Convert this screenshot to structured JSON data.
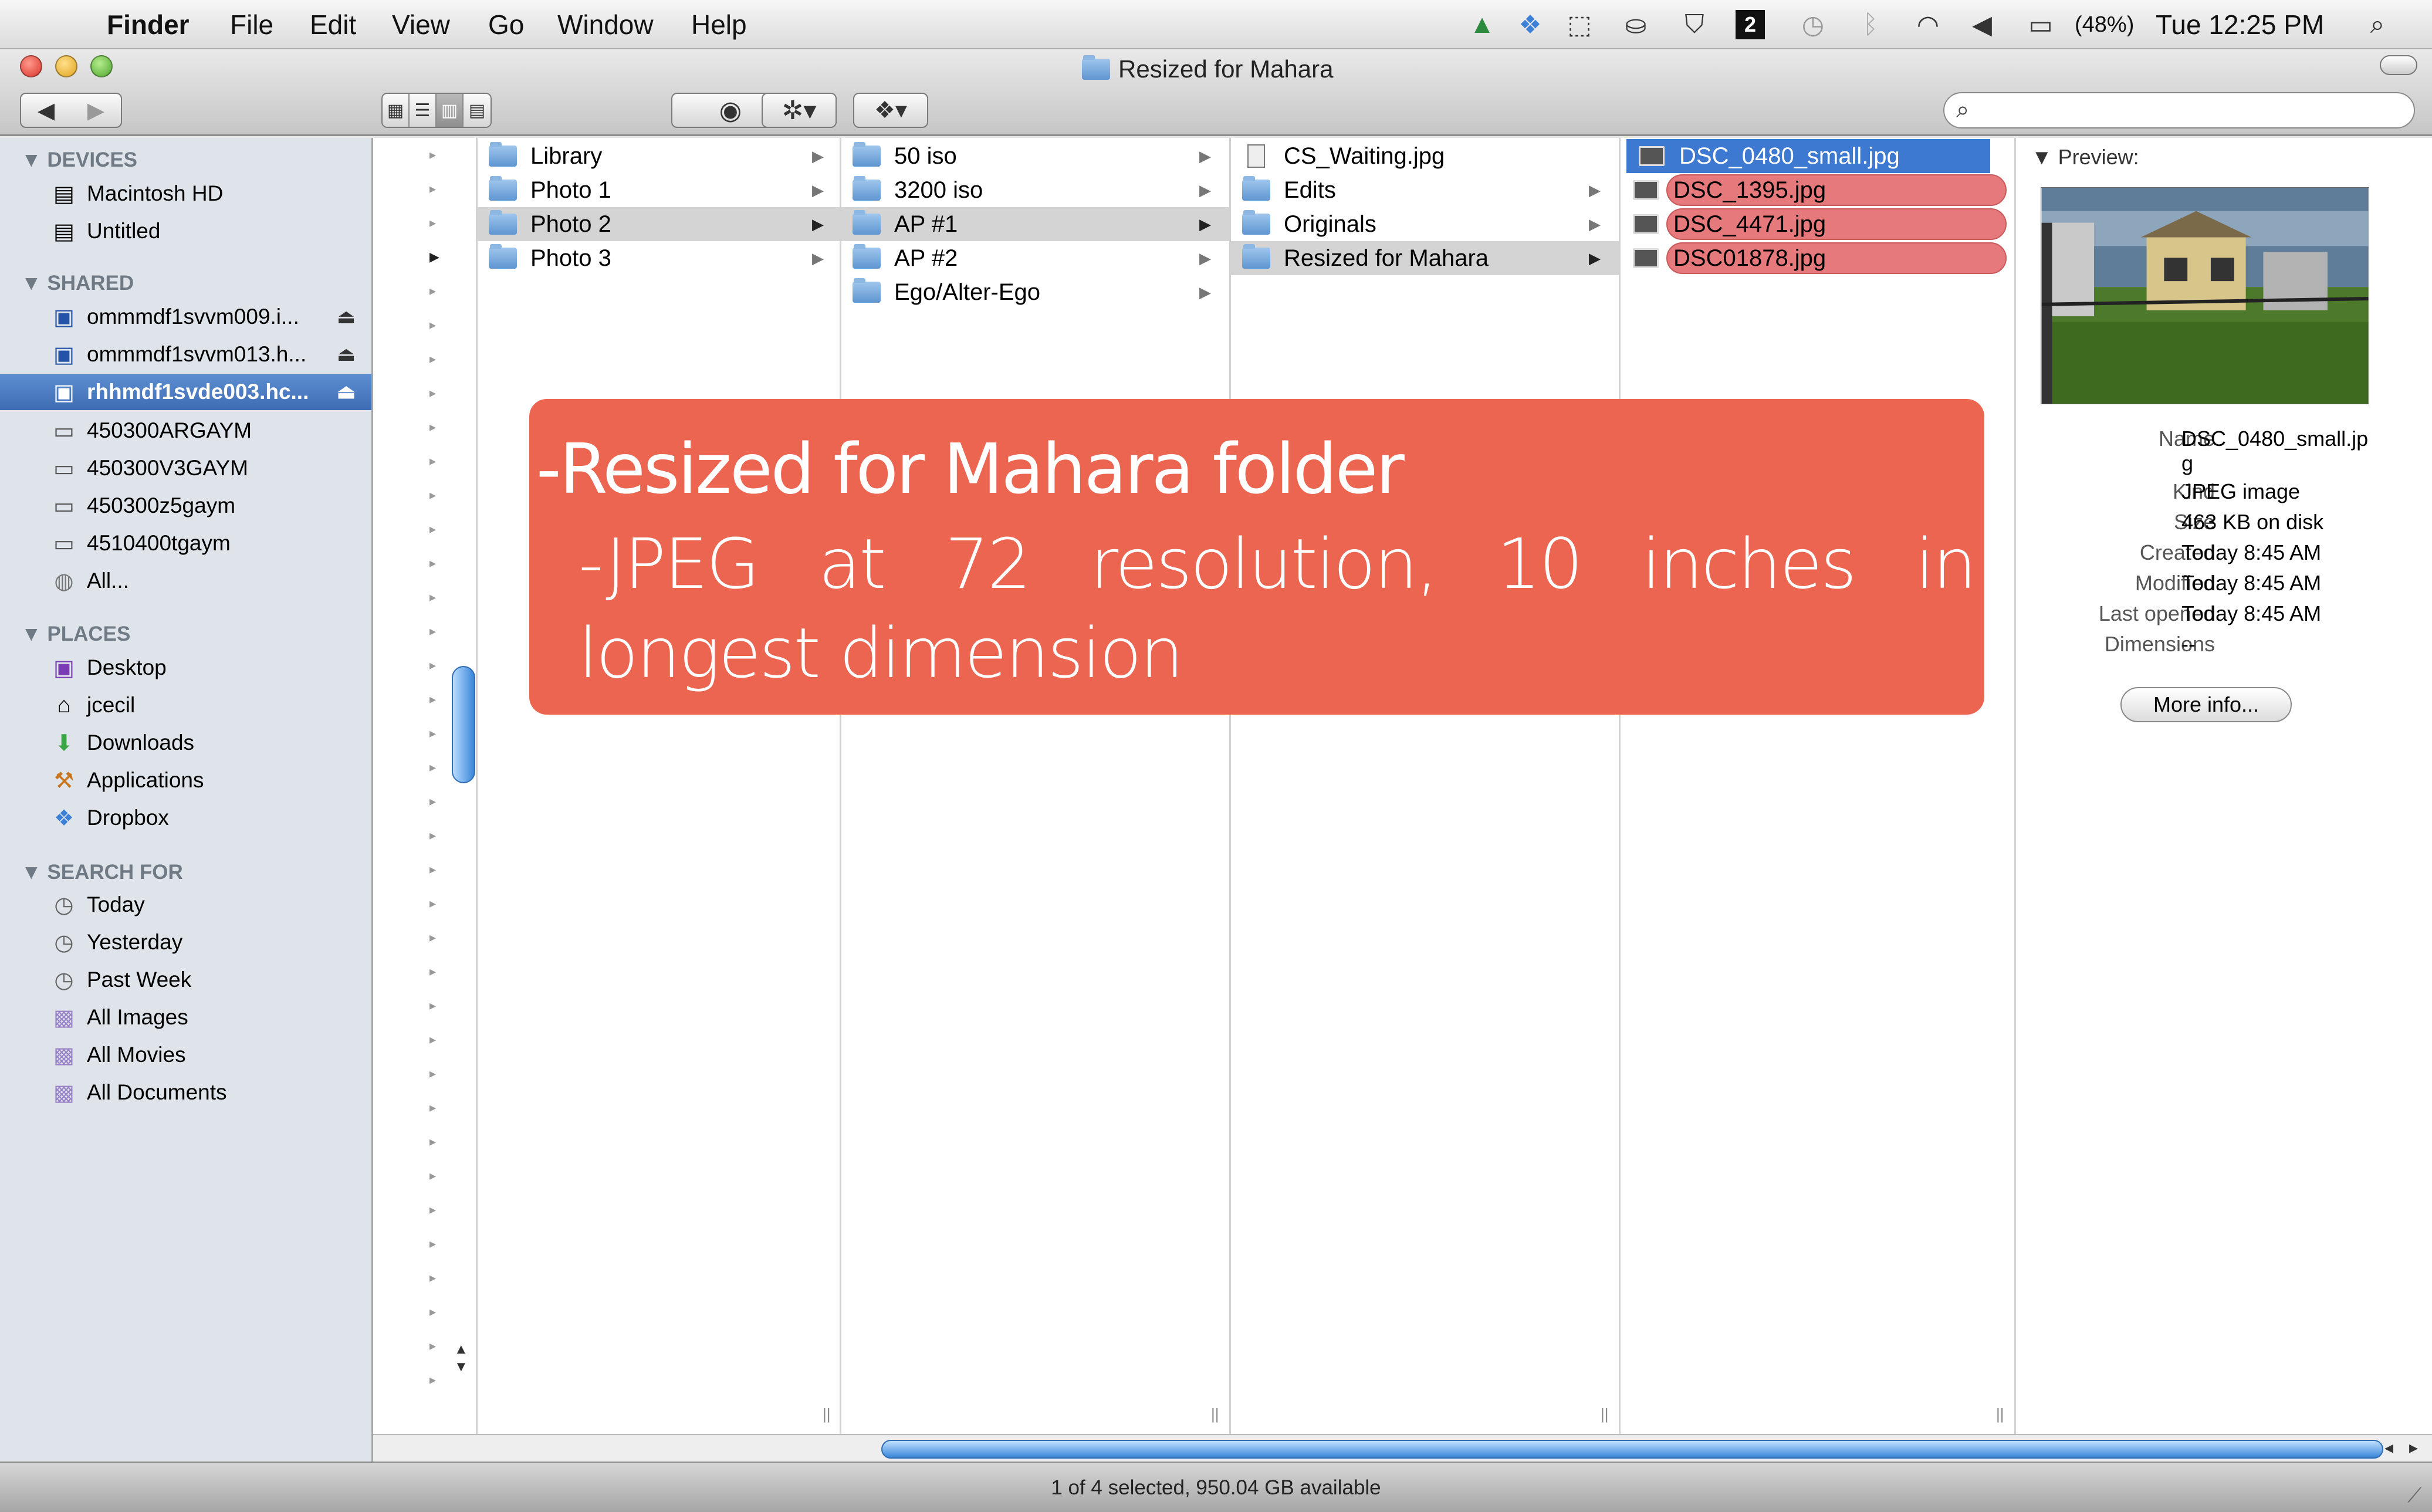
{
  "menubar": {
    "app": "Finder",
    "menus": [
      "File",
      "Edit",
      "View",
      "Go",
      "Window",
      "Help"
    ],
    "battery": "(48%)",
    "clock": "Tue 12:25 PM",
    "badge": "2"
  },
  "window": {
    "title": "Resized for Mahara",
    "search_placeholder": ""
  },
  "sidebar": {
    "devices_header": "DEVICES",
    "devices": [
      "Macintosh HD",
      "Untitled"
    ],
    "shared_header": "SHARED",
    "shared": [
      "ommmdf1svvm009.i...",
      "ommmdf1svvm013.h...",
      "rhhmdf1svde003.hc...",
      "450300ARGAYM",
      "450300V3GAYM",
      "450300z5gaym",
      "4510400tgaym",
      "All..."
    ],
    "places_header": "PLACES",
    "places": [
      "Desktop",
      "jcecil",
      "Downloads",
      "Applications",
      "Dropbox"
    ],
    "search_header": "SEARCH FOR",
    "search": [
      "Today",
      "Yesterday",
      "Past Week",
      "All Images",
      "All Movies",
      "All Documents"
    ]
  },
  "columns": {
    "col1": [
      "Library",
      "Photo 1",
      "Photo 2",
      "Photo 3"
    ],
    "col2": [
      "50 iso",
      "3200 iso",
      "AP #1",
      "AP #2",
      "Ego/Alter-Ego"
    ],
    "col3": [
      "CS_Waiting.jpg",
      "Edits",
      "Originals",
      "Resized for Mahara"
    ],
    "col4": [
      "DSC_0480_small.jpg",
      "DSC_1395.jpg",
      "DSC_4471.jpg",
      "DSC01878.jpg"
    ]
  },
  "preview": {
    "header": "Preview:",
    "name_k": "Name",
    "name_v1": "DSC_0480_small.jp",
    "name_v2": "g",
    "kind_k": "Kind",
    "kind_v": "JPEG image",
    "size_k": "Size",
    "size_v": "463 KB on disk",
    "created_k": "Created",
    "created_v": "Today 8:45 AM",
    "modified_k": "Modified",
    "modified_v": "Today 8:45 AM",
    "opened_k": "Last opened",
    "opened_v": "Today 8:45 AM",
    "dims_k": "Dimensions",
    "dims_v": "--",
    "more": "More info..."
  },
  "status": "1 of 4 selected, 950.04 GB available",
  "overlay": {
    "line1": "-Resized for Mahara folder",
    "line2": "-JPEG at 72 resolution, 10 inches in longest dimension"
  },
  "colors": {
    "selection": "#3d78d1",
    "overlay": "#eb6550",
    "red_label": "#e5797b"
  }
}
